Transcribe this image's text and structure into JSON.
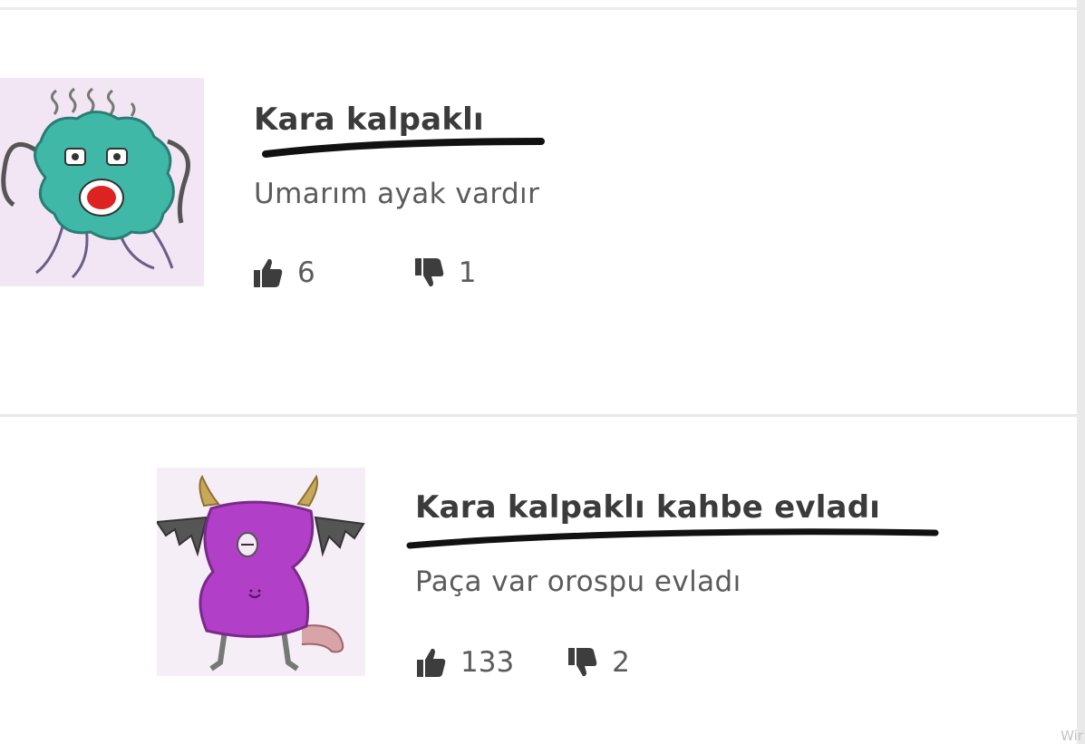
{
  "comments": [
    {
      "author": "Kara kalpaklı",
      "text": "Umarım ayak vardır",
      "likes": "6",
      "dislikes": "1",
      "avatar_icon": "teal-germ-monster-icon",
      "avatar_color": "#3fb8a8"
    },
    {
      "author": "Kara kalpaklı kahbe evladı",
      "text": "Paça var orospu evladı",
      "likes": "133",
      "dislikes": "2",
      "avatar_icon": "purple-bat-monster-icon",
      "avatar_color": "#b23fc8"
    }
  ],
  "watermark": "Wir",
  "colors": {
    "text": "#5b5b5b",
    "author": "#3b3b3b",
    "scribble": "#111111"
  }
}
